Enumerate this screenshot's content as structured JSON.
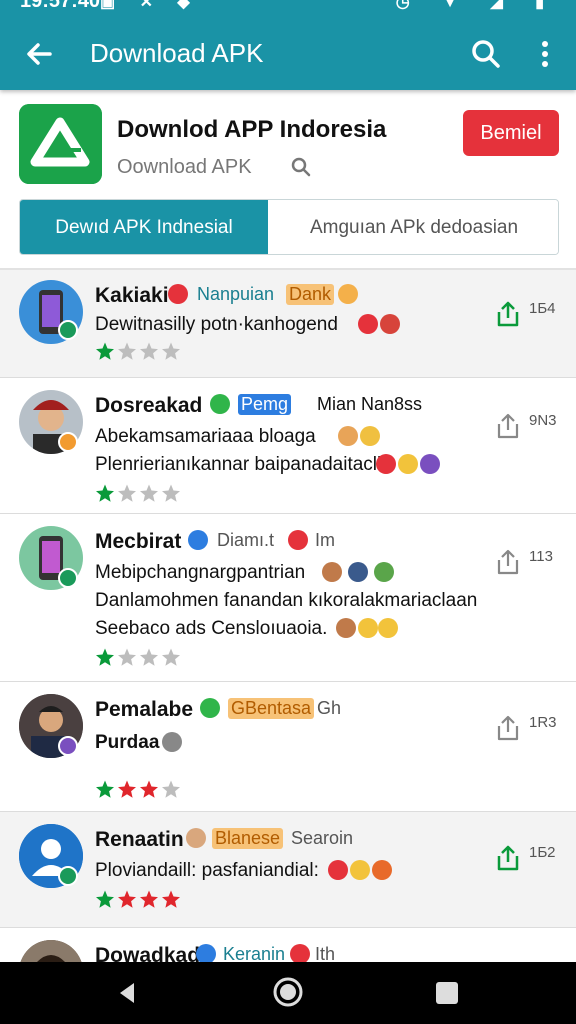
{
  "status_bar": {
    "time": "19:57:40"
  },
  "app_bar": {
    "title": "Download APK"
  },
  "app_header": {
    "name": "Downlod APP Indoresia",
    "subtitle": "Oownload APK",
    "button_label": "Bemiel"
  },
  "tabs": [
    {
      "label": "Dewıd APK Indnesial",
      "active": true
    },
    {
      "label": "Amguıan APk dedoasian",
      "active": false
    }
  ],
  "items": [
    {
      "name": "Kakiaki",
      "tag": "Nanpuian",
      "tag2": "Dank",
      "lines": [
        "Dewitnasilly potn·kanhogend"
      ],
      "stars": 1,
      "count": "1Б4"
    },
    {
      "name": "Dosreakad",
      "tag": "Pemg",
      "tag2": "Mian Nan8ss",
      "lines": [
        "Abekamsamariaaa bloaga",
        "Plenrierianıkannar baipanadaitacll"
      ],
      "stars": 1,
      "count": "9Ν3"
    },
    {
      "name": "Mecbirat",
      "tag": "Diamı.t",
      "tag2": "Im",
      "lines": [
        "Mebipchangnargpantrian",
        "Danlamohmen fanandan kıkoralakmariaclaan",
        "Seebaco ads Censloıuaoia."
      ],
      "stars": 1,
      "count": "113"
    },
    {
      "name": "Pemalabe",
      "tag": "GBentasa",
      "tag2": "Gh",
      "lines": [
        "Purdaa"
      ],
      "stars": 3,
      "count": "1R3"
    },
    {
      "name": "Renaatin",
      "tag": "Blanese",
      "tag2": "Searoin",
      "lines": [
        "Ploviandaill: pasfaniandial:"
      ],
      "stars": 4,
      "count": "1Ƃ2"
    },
    {
      "name": "Dowadkad",
      "tag": "Keranin",
      "tag2": "Ith",
      "lines": [],
      "stars": 0,
      "count": ""
    }
  ],
  "colors": {
    "app_bar": "#1a93a6",
    "primary_button": "#e5323b",
    "star_green": "#0a9a3a",
    "star_red": "#e0262c",
    "star_empty": "#bdbdbd"
  }
}
